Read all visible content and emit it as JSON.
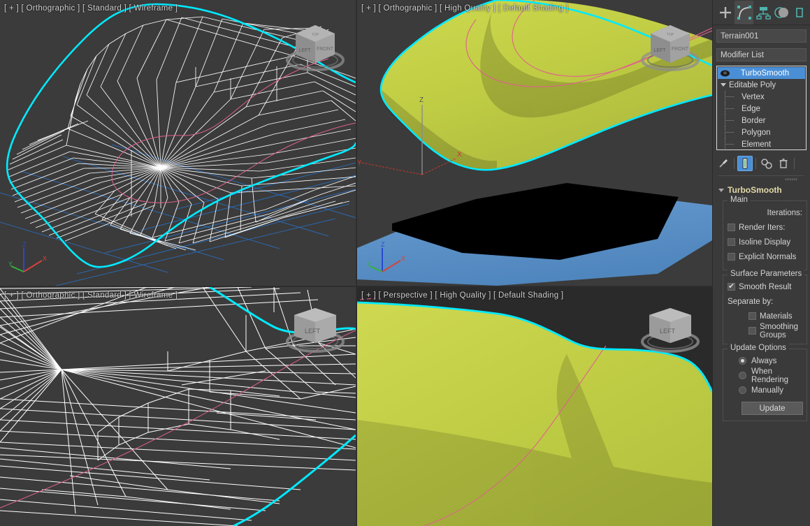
{
  "viewports": [
    {
      "id": "top-left",
      "label": "[ + ] [ Orthographic ] [ Standard ] [ Wireframe ]",
      "shading": "Wireframe",
      "active": false,
      "axis_tripod": {
        "x": "X",
        "y": "Y",
        "z": "Z"
      },
      "viewcube_faces": [
        "LEFT",
        "FRONT",
        "TOP"
      ]
    },
    {
      "id": "top-right",
      "label": "[ + ] [ Orthographic ] [ High Quality ] [ Default Shading ]",
      "shading": "Default Shading",
      "active": false,
      "axis_tripod": {
        "x": "X",
        "y": "Y",
        "z": "Z"
      },
      "gizmo_tripod": {
        "x": "X",
        "y": "Y",
        "z": "Z"
      },
      "viewcube_faces": [
        "LEFT",
        "FRONT",
        "TOP"
      ]
    },
    {
      "id": "bottom-left",
      "label": "[ + ] [ Orthographic ] [ Standard ] [ Wireframe ]",
      "shading": "Wireframe",
      "active": false,
      "viewcube_faces": [
        "LEFT"
      ]
    },
    {
      "id": "bottom-right",
      "label": "[ + ] [ Perspective ] [ High Quality ] [ Default Shading ]",
      "shading": "Default Shading",
      "active": true,
      "viewcube_faces": [
        "LEFT"
      ]
    }
  ],
  "colors": {
    "viewport_bg": "#3b3b3b",
    "selection_highlight": "#00eaff",
    "terrain_surface": "#c2cf45",
    "water_plane": "#5b92c8",
    "black_plane": "#000000",
    "wireframe": "#ffffff",
    "spline_contour": "#e0608f",
    "home_grid": "#2a6ab5",
    "axis_x": "#d8423a",
    "axis_y": "#33b13b",
    "axis_z": "#2b48d0",
    "ui_accent_blue": "#4a8fd6",
    "rollout_title": "#e3d9a8",
    "panel_bg": "#3a3a3a",
    "active_viewport_border": "#b3a068"
  },
  "command_panel": {
    "tabs": [
      {
        "name": "create",
        "icon": "plus-icon",
        "selected": false
      },
      {
        "name": "modify",
        "icon": "modify-curve-icon",
        "selected": true
      },
      {
        "name": "hierarchy",
        "icon": "hierarchy-icon",
        "selected": false
      },
      {
        "name": "motion",
        "icon": "motion-circles-icon",
        "selected": false
      },
      {
        "name": "display",
        "icon": "display-icon",
        "selected": false
      }
    ],
    "object_name": "Terrain001",
    "modifier_list_label": "Modifier List",
    "modifier_stack": [
      {
        "label": "TurboSmooth",
        "selected": true,
        "type": "modifier",
        "icon": "lightbulb-icon"
      },
      {
        "label": "Editable Poly",
        "selected": false,
        "type": "base",
        "expanded": true
      },
      {
        "label": "Vertex",
        "selected": false,
        "type": "sub"
      },
      {
        "label": "Edge",
        "selected": false,
        "type": "sub"
      },
      {
        "label": "Border",
        "selected": false,
        "type": "sub"
      },
      {
        "label": "Polygon",
        "selected": false,
        "type": "sub"
      },
      {
        "label": "Element",
        "selected": false,
        "type": "sub"
      }
    ],
    "stack_toolbar": [
      {
        "name": "pin-stack-button",
        "icon": "pin-icon",
        "active": false
      },
      {
        "name": "show-end-result-button",
        "icon": "show-end-result-icon",
        "active": true
      },
      {
        "name": "make-unique-button",
        "icon": "make-unique-icon",
        "active": false
      },
      {
        "name": "remove-modifier-button",
        "icon": "trash-icon",
        "active": false
      }
    ],
    "rollout": {
      "title": "TurboSmooth",
      "groups": [
        {
          "title": "Main",
          "rows": [
            {
              "kind": "spinner-label",
              "label": "Iterations:"
            },
            {
              "kind": "checkbox",
              "label": "Render Iters:",
              "checked": false
            },
            {
              "kind": "checkbox",
              "label": "Isoline Display",
              "checked": false
            },
            {
              "kind": "checkbox",
              "label": "Explicit Normals",
              "checked": false
            }
          ]
        },
        {
          "title": "Surface Parameters",
          "rows": [
            {
              "kind": "checkbox",
              "label": "Smooth Result",
              "checked": true
            },
            {
              "kind": "label",
              "label": "Separate by:"
            },
            {
              "kind": "checkbox",
              "label": "Materials",
              "checked": false,
              "indent": 2
            },
            {
              "kind": "checkbox",
              "label": "Smoothing Groups",
              "checked": false,
              "indent": 2
            }
          ]
        },
        {
          "title": "Update Options",
          "rows": [
            {
              "kind": "radio",
              "label": "Always",
              "checked": true
            },
            {
              "kind": "radio",
              "label": "When Rendering",
              "checked": false
            },
            {
              "kind": "radio",
              "label": "Manually",
              "checked": false
            },
            {
              "kind": "button",
              "label": "Update"
            }
          ]
        }
      ]
    }
  }
}
